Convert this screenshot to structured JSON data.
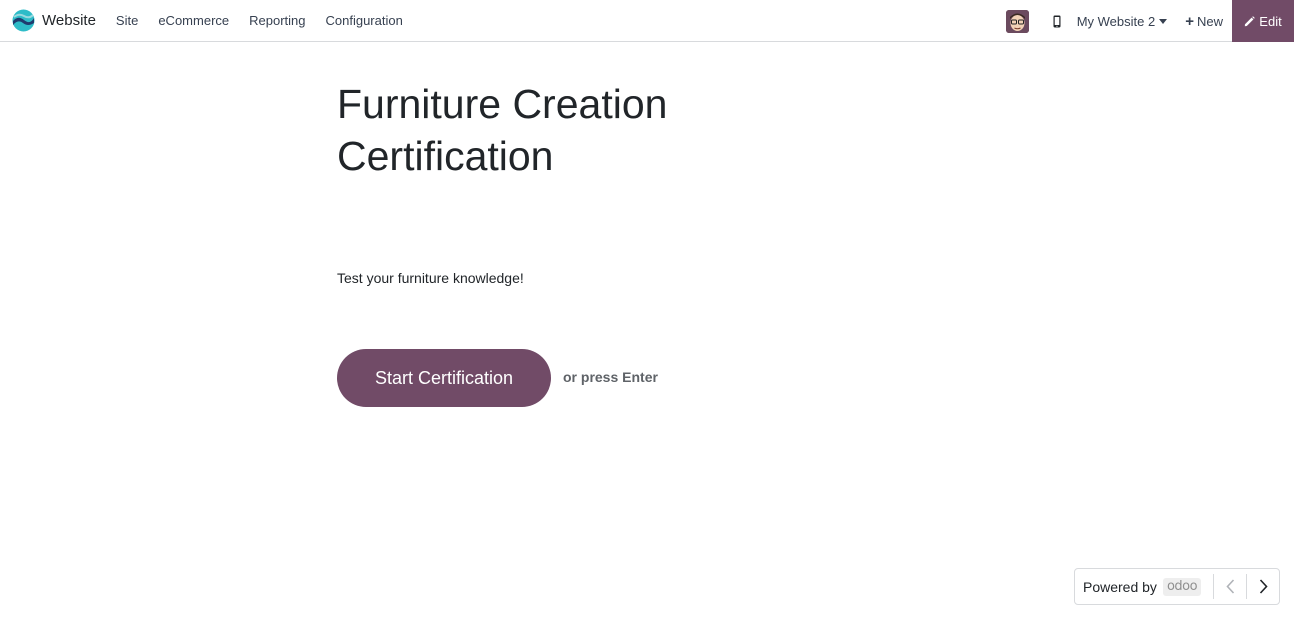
{
  "topbar": {
    "app_name": "Website",
    "menu": [
      {
        "label": "Site"
      },
      {
        "label": "eCommerce"
      },
      {
        "label": "Reporting"
      },
      {
        "label": "Configuration"
      }
    ],
    "site_switcher": "My Website 2",
    "new_label": "New",
    "edit_label": "Edit",
    "icons": {
      "logo": "odoo-website-logo",
      "avatar": "user-avatar",
      "mobile_preview": "mobile-icon",
      "new": "plus-icon",
      "edit": "pencil-icon"
    }
  },
  "main": {
    "title": "Furniture Creation Certification",
    "subtitle": "Test your furniture knowledge!",
    "start_button": "Start Certification",
    "hint": "or press Enter"
  },
  "footer": {
    "powered_by": "Powered by",
    "brand": "odoo"
  },
  "colors": {
    "primary": "#714b67",
    "text": "#212529",
    "muted": "#5f6368"
  }
}
